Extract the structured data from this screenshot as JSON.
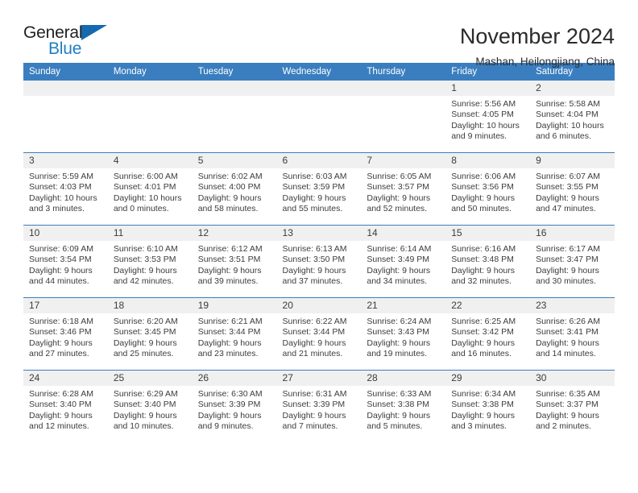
{
  "brand": {
    "name_top": "General",
    "name_bottom": "Blue",
    "triangle_color": "#1569b0",
    "blue_color": "#1c7fc4"
  },
  "header": {
    "title": "November 2024",
    "subtitle": "Mashan, Heilongjiang, China"
  },
  "theme": {
    "header_blue": "#3a7ebf",
    "daynum_gray": "#f0f0f0",
    "text": "#3c3c3c"
  },
  "weekday_headers": [
    "Sunday",
    "Monday",
    "Tuesday",
    "Wednesday",
    "Thursday",
    "Friday",
    "Saturday"
  ],
  "labels": {
    "sunrise": "Sunrise:",
    "sunset": "Sunset:",
    "daylight": "Daylight:"
  },
  "weeks": [
    [
      {
        "day": ""
      },
      {
        "day": ""
      },
      {
        "day": ""
      },
      {
        "day": ""
      },
      {
        "day": ""
      },
      {
        "day": "1",
        "sunrise": "Sunrise: 5:56 AM",
        "sunset": "Sunset: 4:05 PM",
        "daylight": "Daylight: 10 hours and 9 minutes."
      },
      {
        "day": "2",
        "sunrise": "Sunrise: 5:58 AM",
        "sunset": "Sunset: 4:04 PM",
        "daylight": "Daylight: 10 hours and 6 minutes."
      }
    ],
    [
      {
        "day": "3",
        "sunrise": "Sunrise: 5:59 AM",
        "sunset": "Sunset: 4:03 PM",
        "daylight": "Daylight: 10 hours and 3 minutes."
      },
      {
        "day": "4",
        "sunrise": "Sunrise: 6:00 AM",
        "sunset": "Sunset: 4:01 PM",
        "daylight": "Daylight: 10 hours and 0 minutes."
      },
      {
        "day": "5",
        "sunrise": "Sunrise: 6:02 AM",
        "sunset": "Sunset: 4:00 PM",
        "daylight": "Daylight: 9 hours and 58 minutes."
      },
      {
        "day": "6",
        "sunrise": "Sunrise: 6:03 AM",
        "sunset": "Sunset: 3:59 PM",
        "daylight": "Daylight: 9 hours and 55 minutes."
      },
      {
        "day": "7",
        "sunrise": "Sunrise: 6:05 AM",
        "sunset": "Sunset: 3:57 PM",
        "daylight": "Daylight: 9 hours and 52 minutes."
      },
      {
        "day": "8",
        "sunrise": "Sunrise: 6:06 AM",
        "sunset": "Sunset: 3:56 PM",
        "daylight": "Daylight: 9 hours and 50 minutes."
      },
      {
        "day": "9",
        "sunrise": "Sunrise: 6:07 AM",
        "sunset": "Sunset: 3:55 PM",
        "daylight": "Daylight: 9 hours and 47 minutes."
      }
    ],
    [
      {
        "day": "10",
        "sunrise": "Sunrise: 6:09 AM",
        "sunset": "Sunset: 3:54 PM",
        "daylight": "Daylight: 9 hours and 44 minutes."
      },
      {
        "day": "11",
        "sunrise": "Sunrise: 6:10 AM",
        "sunset": "Sunset: 3:53 PM",
        "daylight": "Daylight: 9 hours and 42 minutes."
      },
      {
        "day": "12",
        "sunrise": "Sunrise: 6:12 AM",
        "sunset": "Sunset: 3:51 PM",
        "daylight": "Daylight: 9 hours and 39 minutes."
      },
      {
        "day": "13",
        "sunrise": "Sunrise: 6:13 AM",
        "sunset": "Sunset: 3:50 PM",
        "daylight": "Daylight: 9 hours and 37 minutes."
      },
      {
        "day": "14",
        "sunrise": "Sunrise: 6:14 AM",
        "sunset": "Sunset: 3:49 PM",
        "daylight": "Daylight: 9 hours and 34 minutes."
      },
      {
        "day": "15",
        "sunrise": "Sunrise: 6:16 AM",
        "sunset": "Sunset: 3:48 PM",
        "daylight": "Daylight: 9 hours and 32 minutes."
      },
      {
        "day": "16",
        "sunrise": "Sunrise: 6:17 AM",
        "sunset": "Sunset: 3:47 PM",
        "daylight": "Daylight: 9 hours and 30 minutes."
      }
    ],
    [
      {
        "day": "17",
        "sunrise": "Sunrise: 6:18 AM",
        "sunset": "Sunset: 3:46 PM",
        "daylight": "Daylight: 9 hours and 27 minutes."
      },
      {
        "day": "18",
        "sunrise": "Sunrise: 6:20 AM",
        "sunset": "Sunset: 3:45 PM",
        "daylight": "Daylight: 9 hours and 25 minutes."
      },
      {
        "day": "19",
        "sunrise": "Sunrise: 6:21 AM",
        "sunset": "Sunset: 3:44 PM",
        "daylight": "Daylight: 9 hours and 23 minutes."
      },
      {
        "day": "20",
        "sunrise": "Sunrise: 6:22 AM",
        "sunset": "Sunset: 3:44 PM",
        "daylight": "Daylight: 9 hours and 21 minutes."
      },
      {
        "day": "21",
        "sunrise": "Sunrise: 6:24 AM",
        "sunset": "Sunset: 3:43 PM",
        "daylight": "Daylight: 9 hours and 19 minutes."
      },
      {
        "day": "22",
        "sunrise": "Sunrise: 6:25 AM",
        "sunset": "Sunset: 3:42 PM",
        "daylight": "Daylight: 9 hours and 16 minutes."
      },
      {
        "day": "23",
        "sunrise": "Sunrise: 6:26 AM",
        "sunset": "Sunset: 3:41 PM",
        "daylight": "Daylight: 9 hours and 14 minutes."
      }
    ],
    [
      {
        "day": "24",
        "sunrise": "Sunrise: 6:28 AM",
        "sunset": "Sunset: 3:40 PM",
        "daylight": "Daylight: 9 hours and 12 minutes."
      },
      {
        "day": "25",
        "sunrise": "Sunrise: 6:29 AM",
        "sunset": "Sunset: 3:40 PM",
        "daylight": "Daylight: 9 hours and 10 minutes."
      },
      {
        "day": "26",
        "sunrise": "Sunrise: 6:30 AM",
        "sunset": "Sunset: 3:39 PM",
        "daylight": "Daylight: 9 hours and 9 minutes."
      },
      {
        "day": "27",
        "sunrise": "Sunrise: 6:31 AM",
        "sunset": "Sunset: 3:39 PM",
        "daylight": "Daylight: 9 hours and 7 minutes."
      },
      {
        "day": "28",
        "sunrise": "Sunrise: 6:33 AM",
        "sunset": "Sunset: 3:38 PM",
        "daylight": "Daylight: 9 hours and 5 minutes."
      },
      {
        "day": "29",
        "sunrise": "Sunrise: 6:34 AM",
        "sunset": "Sunset: 3:38 PM",
        "daylight": "Daylight: 9 hours and 3 minutes."
      },
      {
        "day": "30",
        "sunrise": "Sunrise: 6:35 AM",
        "sunset": "Sunset: 3:37 PM",
        "daylight": "Daylight: 9 hours and 2 minutes."
      }
    ]
  ]
}
